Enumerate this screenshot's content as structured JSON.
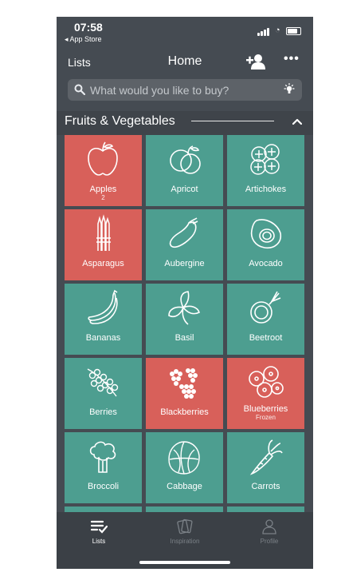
{
  "status_bar": {
    "time": "07:58",
    "back_app": "◂ App Store"
  },
  "nav": {
    "left_label": "Lists",
    "title": "Home",
    "more_glyph": "•••"
  },
  "search": {
    "placeholder": "What would you like to buy?"
  },
  "section": {
    "title": "Fruits & Vegetables"
  },
  "colors": {
    "selected": "#d8605a",
    "unselected": "#4d9e90",
    "background": "#454b52"
  },
  "items": [
    {
      "label": "Apples",
      "sub": "2",
      "selected": true,
      "icon": "apple-icon"
    },
    {
      "label": "Apricot",
      "sub": "",
      "selected": false,
      "icon": "apricot-icon"
    },
    {
      "label": "Artichokes",
      "sub": "",
      "selected": false,
      "icon": "artichoke-icon"
    },
    {
      "label": "Asparagus",
      "sub": "",
      "selected": true,
      "icon": "asparagus-icon"
    },
    {
      "label": "Aubergine",
      "sub": "",
      "selected": false,
      "icon": "aubergine-icon"
    },
    {
      "label": "Avocado",
      "sub": "",
      "selected": false,
      "icon": "avocado-icon"
    },
    {
      "label": "Bananas",
      "sub": "",
      "selected": false,
      "icon": "banana-icon"
    },
    {
      "label": "Basil",
      "sub": "",
      "selected": false,
      "icon": "basil-icon"
    },
    {
      "label": "Beetroot",
      "sub": "",
      "selected": false,
      "icon": "beetroot-icon"
    },
    {
      "label": "Berries",
      "sub": "",
      "selected": false,
      "icon": "berries-icon"
    },
    {
      "label": "Blackberries",
      "sub": "",
      "selected": true,
      "icon": "blackberries-icon"
    },
    {
      "label": "Blueberries",
      "sub": "Frozen",
      "selected": true,
      "icon": "blueberries-icon"
    },
    {
      "label": "Broccoli",
      "sub": "",
      "selected": false,
      "icon": "broccoli-icon"
    },
    {
      "label": "Cabbage",
      "sub": "",
      "selected": false,
      "icon": "cabbage-icon"
    },
    {
      "label": "Carrots",
      "sub": "",
      "selected": false,
      "icon": "carrot-icon"
    }
  ],
  "tabs": [
    {
      "label": "Lists",
      "active": true,
      "icon": "lists-icon"
    },
    {
      "label": "Inspiration",
      "active": false,
      "icon": "inspiration-icon"
    },
    {
      "label": "Profile",
      "active": false,
      "icon": "profile-icon"
    }
  ]
}
